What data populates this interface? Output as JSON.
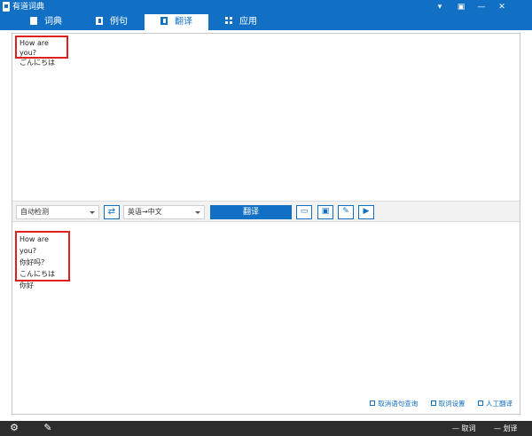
{
  "window": {
    "title": "有道词典",
    "controls": [
      "▾",
      "▣",
      "—",
      "✕"
    ]
  },
  "tabs": [
    {
      "label": "词典",
      "icon": "book-icon",
      "active": false
    },
    {
      "label": "例句",
      "icon": "page-icon",
      "active": false
    },
    {
      "label": "翻译",
      "icon": "page-icon",
      "active": true
    },
    {
      "label": "应用",
      "icon": "apps-icon",
      "active": false
    }
  ],
  "source": {
    "lines": [
      "How are you?",
      "ごんにちは"
    ]
  },
  "toolbar": {
    "from_lang": "自动检测",
    "swap_label": "⇄",
    "to_lang": "英语→中文",
    "translate_label": "翻译",
    "tools": [
      "▭",
      "▣",
      "✎",
      "▶"
    ]
  },
  "result": {
    "lines": [
      "How are you?",
      "你好吗？",
      "こんにちは",
      "你好"
    ]
  },
  "bottom_links": [
    "取消语句查询",
    "取词设置",
    "人工翻译"
  ],
  "statusbar": {
    "left_icons": [
      "gear-icon",
      "microphone-icon"
    ],
    "right_items": [
      "取词",
      "划译"
    ]
  },
  "colors": {
    "accent": "#1170c4",
    "highlight_border": "#e0201c",
    "statusbar_bg": "#2d2d2d"
  }
}
